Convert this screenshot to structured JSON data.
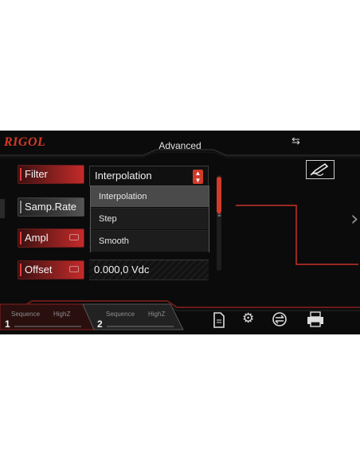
{
  "header": {
    "logo": "RIGOL",
    "title": "Advanced",
    "sync_icon": "sync-arrows-icon",
    "edit_icon": "pen-edit-icon"
  },
  "params": {
    "filter": {
      "label": "Filter",
      "value": "Interpolation"
    },
    "samp_rate": {
      "label": "Samp.Rate"
    },
    "ampl": {
      "label": "Ampl"
    },
    "offset": {
      "label": "Offset",
      "value": "0.000,0 Vdc"
    }
  },
  "dropdown": {
    "options": [
      "Interpolation",
      "Step",
      "Smooth"
    ],
    "selected_index": 0
  },
  "channels": [
    {
      "number": "1",
      "mode": "Sequence",
      "impedance": "HighZ"
    },
    {
      "number": "2",
      "mode": "Sequence",
      "impedance": "HighZ"
    }
  ],
  "toolbar_icons": [
    "document-icon",
    "gear-icon",
    "swap-icon",
    "printer-icon"
  ],
  "colors": {
    "accent": "#d23b2a",
    "background": "#0b0b0b"
  }
}
